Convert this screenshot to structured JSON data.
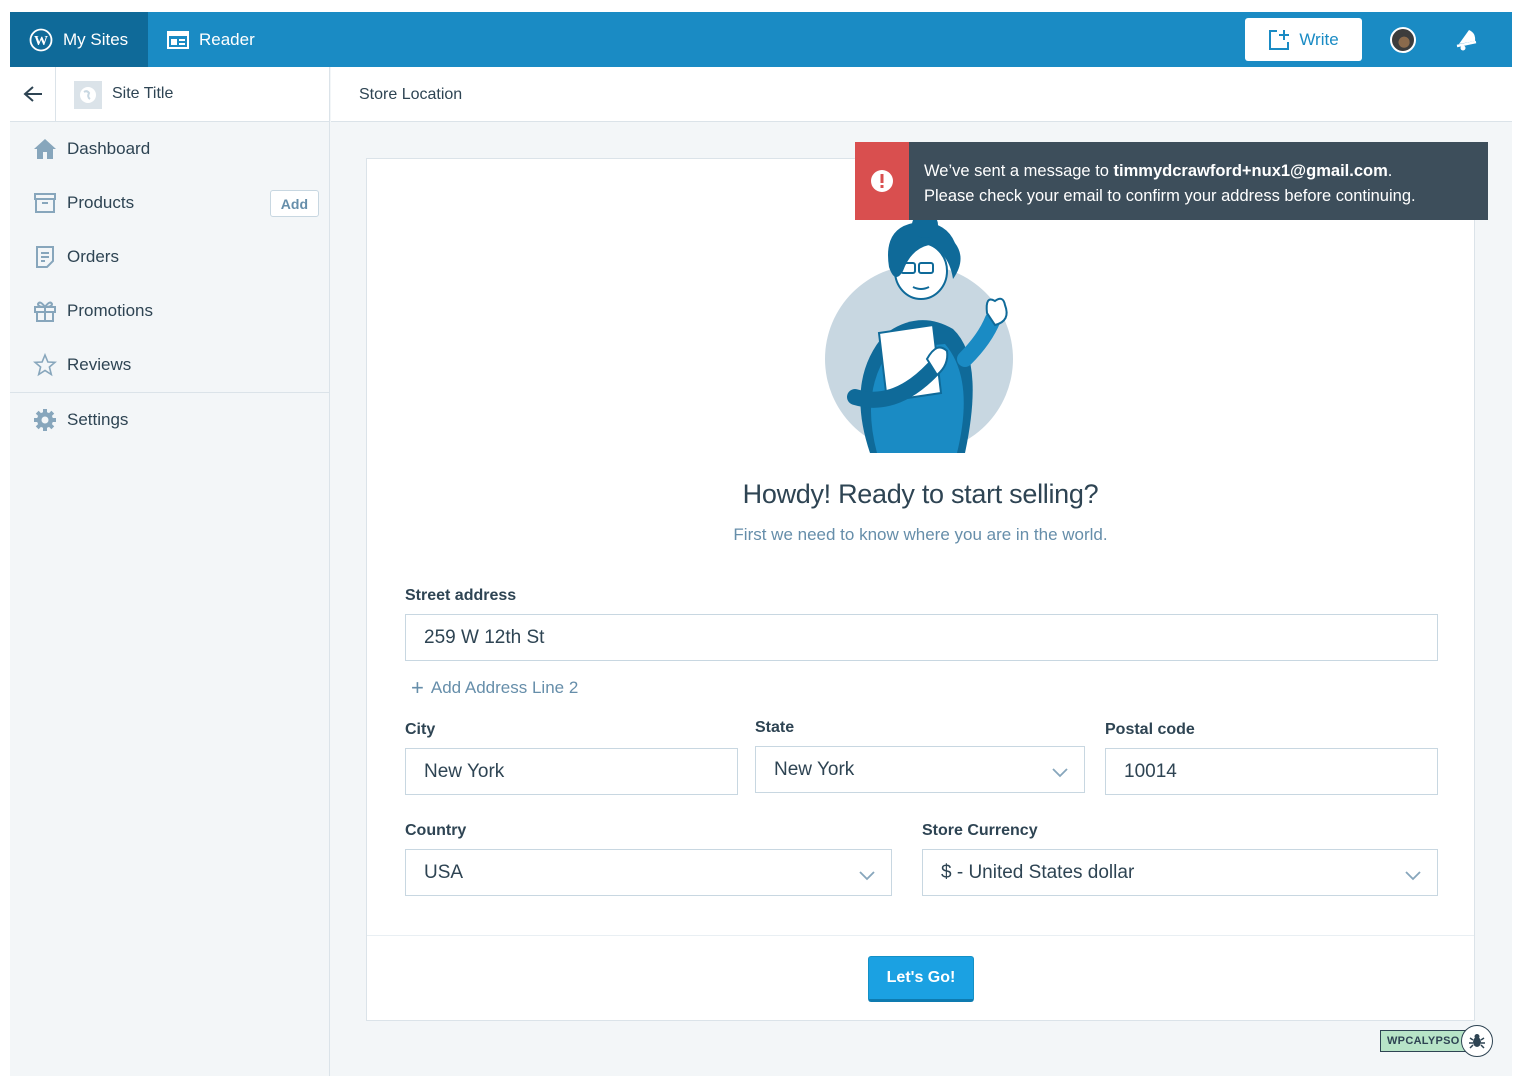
{
  "masterbar": {
    "my_sites": "My Sites",
    "reader": "Reader",
    "write": "Write",
    "icons": [
      "wordpress-logo-icon",
      "reader-icon",
      "write-icon",
      "avatar",
      "notifications-bell-icon"
    ],
    "colors": {
      "bar": "#1a8bc4",
      "active": "#0f6a99"
    }
  },
  "sidebar": {
    "site_title": "Site Title",
    "items": [
      {
        "label": "Dashboard",
        "icon": "house-icon"
      },
      {
        "label": "Products",
        "icon": "box-icon",
        "action": "Add"
      },
      {
        "label": "Orders",
        "icon": "document-icon"
      },
      {
        "label": "Promotions",
        "icon": "gift-icon"
      },
      {
        "label": "Reviews",
        "icon": "star-icon"
      },
      {
        "label": "Settings",
        "icon": "cog-icon"
      }
    ]
  },
  "header": {
    "title": "Store Location"
  },
  "notice": {
    "prefix": "We’ve sent a message to ",
    "email": "timmydcrawford+nux1@gmail.com",
    "suffix": ".",
    "line2": "Please check your email to confirm your address before continuing.",
    "colors": {
      "bg": "#3d4e5b",
      "status": "#d94f4f"
    }
  },
  "setup": {
    "headline": "Howdy! Ready to start selling?",
    "subline": "First we need to know where you are in the world.",
    "street_label": "Street address",
    "street_value": "259 W 12th St",
    "add_line2": "Add Address Line 2",
    "city_label": "City",
    "city_value": "New York",
    "state_label": "State",
    "state_value": "New York",
    "postal_label": "Postal code",
    "postal_value": "10014",
    "country_label": "Country",
    "country_value": "USA",
    "currency_label": "Store Currency",
    "currency_value": "$ - United States dollar",
    "submit": "Let's Go!",
    "colors": {
      "primary": "#1ba1e2"
    }
  },
  "debug": {
    "badge": "WPCALYPSO"
  }
}
